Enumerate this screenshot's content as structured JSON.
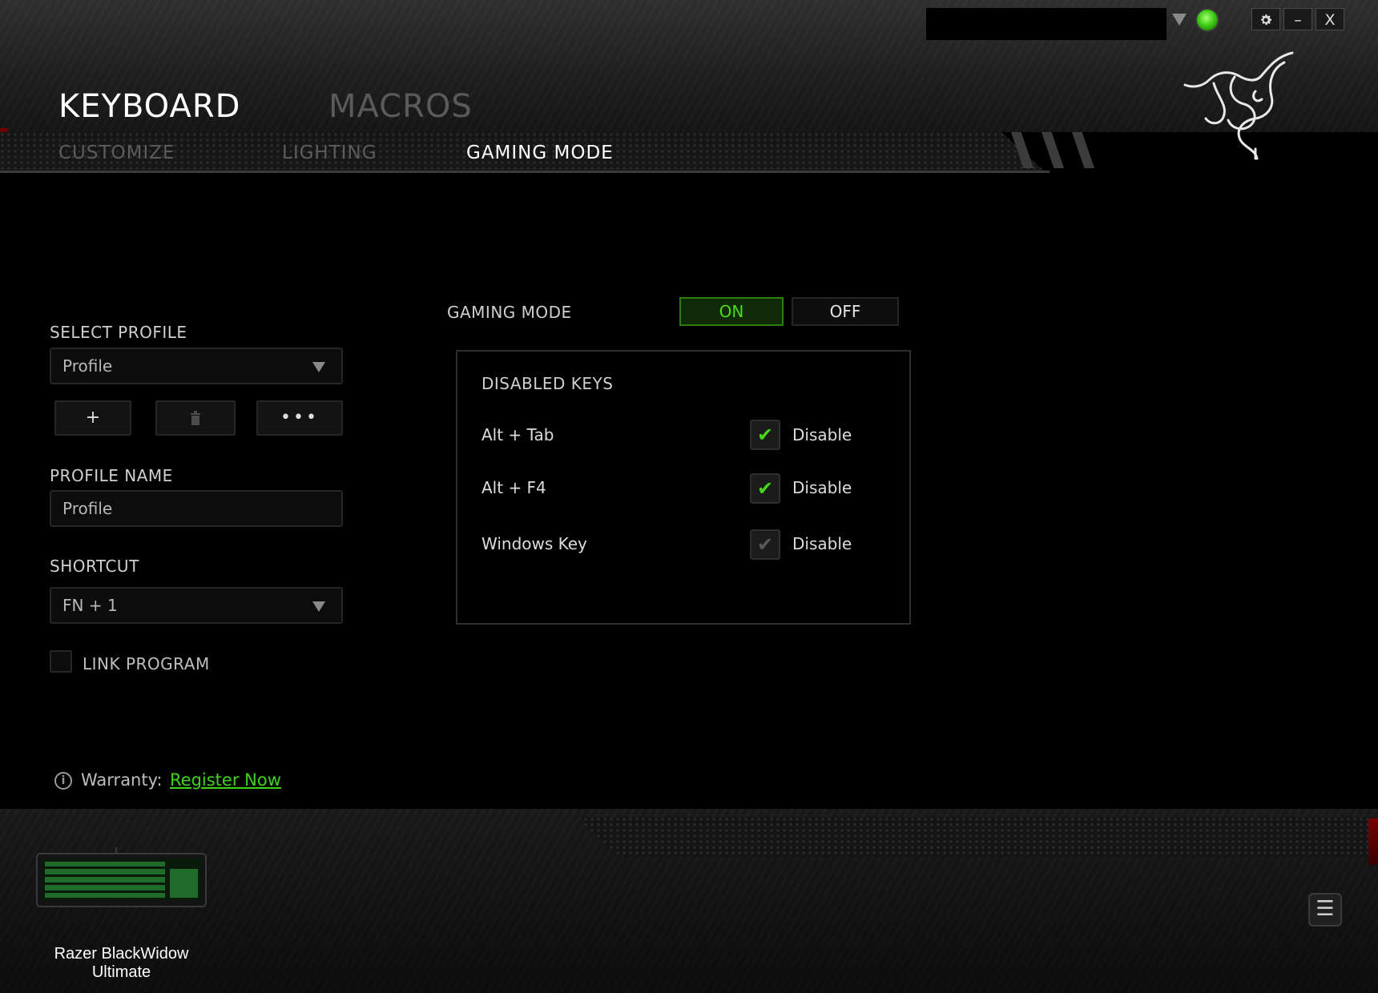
{
  "header": {
    "main_tabs": [
      {
        "label": "KEYBOARD",
        "active": true
      },
      {
        "label": "MACROS",
        "active": false
      }
    ],
    "sub_tabs": [
      {
        "label": "CUSTOMIZE",
        "active": false
      },
      {
        "label": "LIGHTING",
        "active": false
      },
      {
        "label": "GAMING MODE",
        "active": true
      }
    ],
    "window_controls": {
      "settings_icon": "gear-icon",
      "minimize_label": "–",
      "close_label": "X"
    },
    "status_color": "#3ecc15"
  },
  "profile": {
    "select_label": "SELECT PROFILE",
    "selected": "Profile",
    "add_label": "+",
    "delete_label": "🗑",
    "more_label": "•••",
    "name_label": "PROFILE NAME",
    "name_value": "Profile",
    "shortcut_label": "SHORTCUT",
    "shortcut_value": "FN + 1",
    "link_program_label": "LINK PROGRAM",
    "link_program_checked": false
  },
  "gaming_mode": {
    "label": "GAMING MODE",
    "on_label": "ON",
    "off_label": "OFF",
    "state": "ON",
    "disabled_keys_title": "DISABLED KEYS",
    "keys": [
      {
        "name": "Alt + Tab",
        "checkbox_label": "Disable",
        "checked": true
      },
      {
        "name": "Alt + F4",
        "checkbox_label": "Disable",
        "checked": true
      },
      {
        "name": "Windows Key",
        "checkbox_label": "Disable",
        "checked": false
      }
    ]
  },
  "warranty": {
    "label": "Warranty:",
    "link_label": "Register Now"
  },
  "footer": {
    "device_line1": "Razer BlackWidow",
    "device_line2": "Ultimate",
    "menu_label": "☰"
  },
  "colors": {
    "accent_green": "#44d816",
    "razer_red": "#7a0000"
  }
}
